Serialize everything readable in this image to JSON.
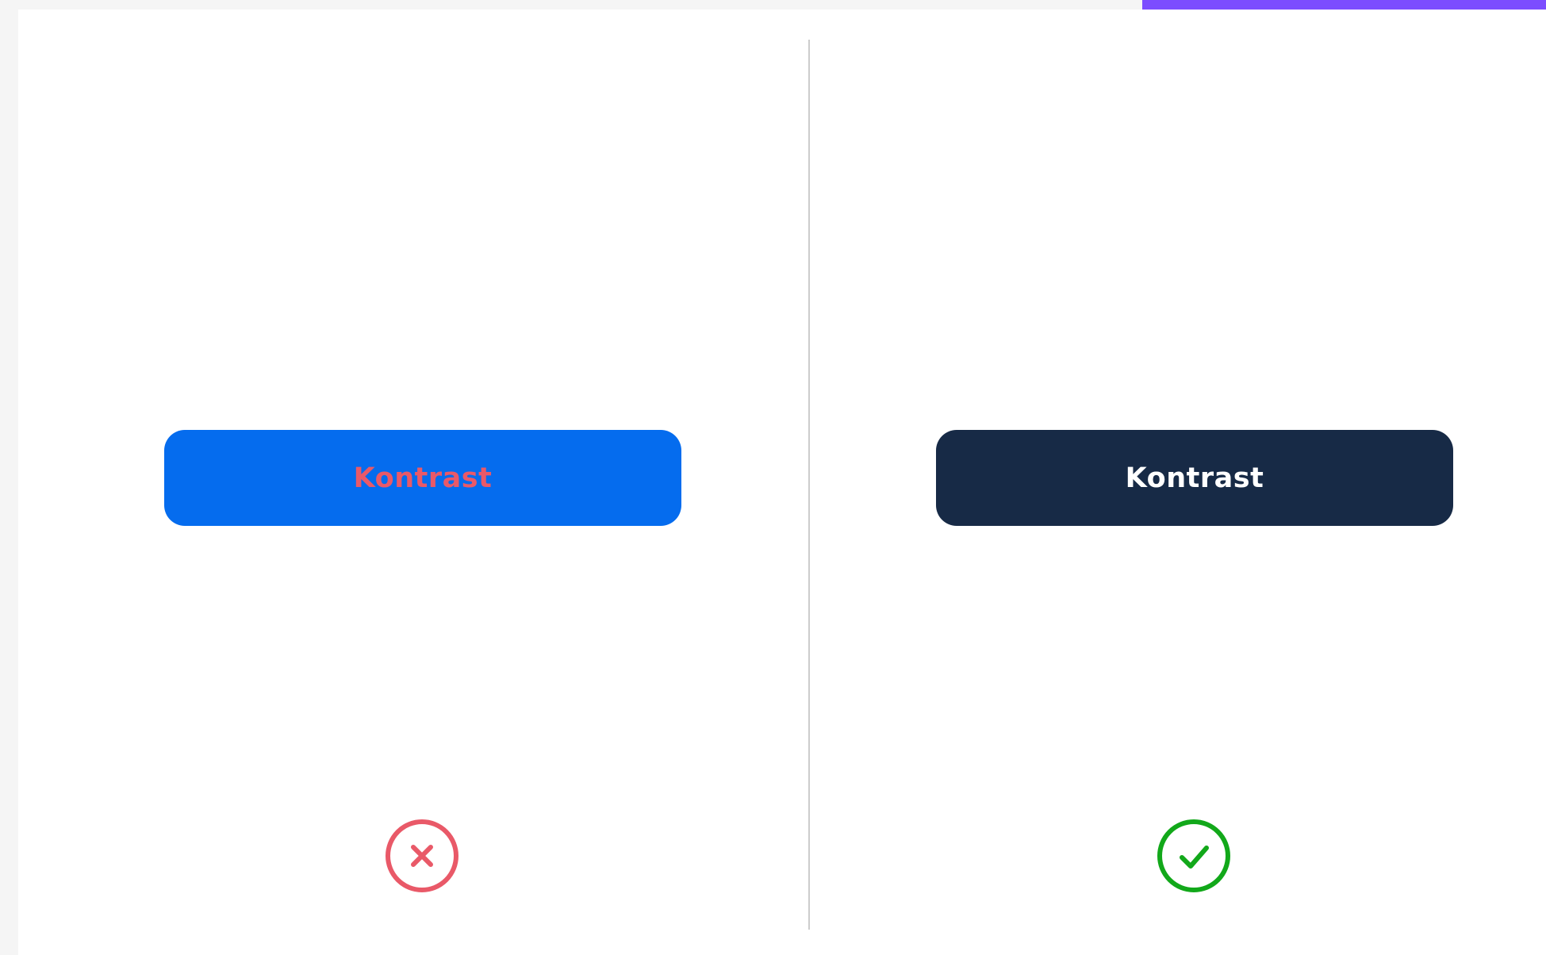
{
  "colors": {
    "page_background": "#f5f5f5",
    "panel_background": "#ffffff",
    "accent_bar": "#7c4dff",
    "divider": "#cccccc",
    "bad_button_bg": "#056cee",
    "bad_button_text": "#e95968",
    "good_button_bg": "#172a46",
    "good_button_text": "#ffffff",
    "bad_icon": "#e95968",
    "good_icon": "#12a81a"
  },
  "bad_example": {
    "button_label": "Kontrast",
    "icon": "x-circle-icon"
  },
  "good_example": {
    "button_label": "Kontrast",
    "icon": "check-circle-icon"
  }
}
